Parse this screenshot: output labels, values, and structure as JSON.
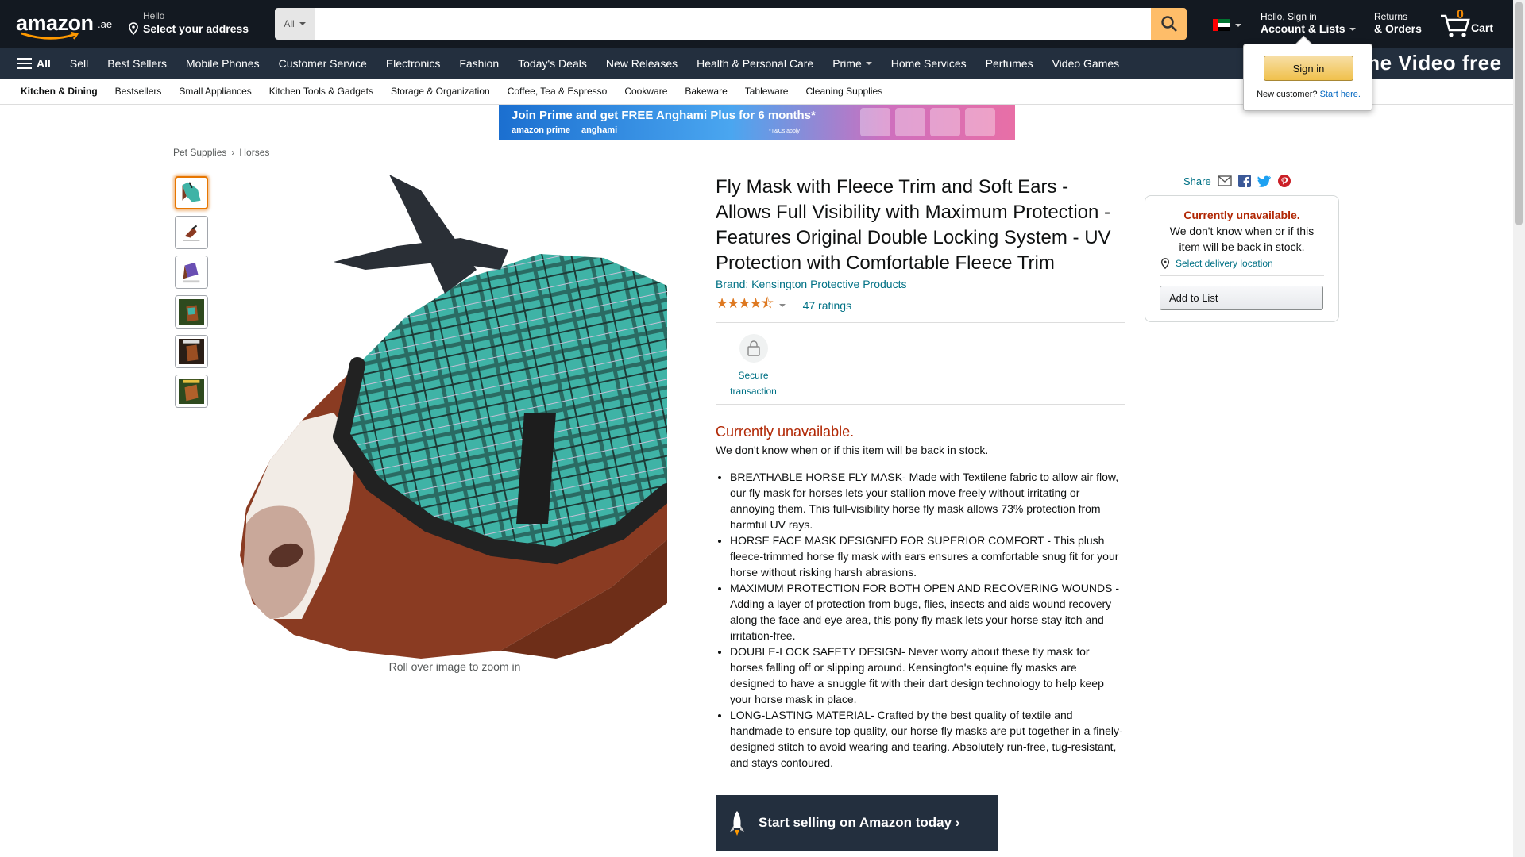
{
  "header": {
    "logo_text": "amazon",
    "logo_tld": ".ae",
    "address_hello": "Hello",
    "address_label": "Select your address",
    "search_category": "All",
    "search_placeholder": "",
    "account_hello": "Hello, Sign in",
    "account_label": "Account & Lists",
    "returns_l1": "Returns",
    "returns_l2": "& Orders",
    "cart_count": "0",
    "cart_label": "Cart"
  },
  "nav": {
    "all_label": "All",
    "items": [
      "Sell",
      "Best Sellers",
      "Mobile Phones",
      "Customer Service",
      "Electronics",
      "Fashion",
      "Today's Deals",
      "New Releases",
      "Health & Personal Care",
      "Prime",
      "Home Services",
      "Perfumes",
      "Video Games"
    ],
    "promo_text": "me Video free"
  },
  "subnav": {
    "items": [
      "Kitchen & Dining",
      "Bestsellers",
      "Small Appliances",
      "Kitchen Tools & Gadgets",
      "Storage & Organization",
      "Coffee, Tea & Espresso",
      "Cookware",
      "Bakeware",
      "Tableware",
      "Cleaning Supplies"
    ]
  },
  "banner": {
    "line1": "Join Prime and get FREE Anghami Plus for 6 months*",
    "brand_a": "amazon prime",
    "brand_b": "anghami",
    "tc": "*T&Cs apply"
  },
  "breadcrumb": [
    "Pet Supplies",
    "Horses"
  ],
  "gallery": {
    "zoom_hint": "Roll over image to zoom in"
  },
  "product": {
    "title": "Fly Mask with Fleece Trim and Soft Ears - Allows Full Visibility with Maximum Protection - Features Original Double Locking System - UV Protection with Comfortable Fleece Trim",
    "brand": "Brand: Kensington Protective Products",
    "stars_value": 4.5,
    "ratings": "47 ratings",
    "secure_label": "Secure transaction",
    "unavailable": "Currently unavailable.",
    "unavailable_sub": "We don't know when or if this item will be back in stock.",
    "bullets": [
      "BREATHABLE HORSE FLY MASK- Made with Textilene fabric to allow air flow, our fly mask for horses lets your stallion move freely without irritating or annoying them. This full-visibility horse fly mask allows 73% protection from harmful UV rays.",
      "HORSE FACE MASK DESIGNED FOR SUPERIOR COMFORT - This plush fleece-trimmed horse fly mask with ears ensures a comfortable snug fit for your horse without risking harsh abrasions.",
      "MAXIMUM PROTECTION FOR BOTH OPEN AND RECOVERING WOUNDS - Adding a layer of protection from bugs, flies, insects and aids wound recovery along the face and eye area, this pony fly mask lets your horse stay itch and irritation-free.",
      "DOUBLE-LOCK SAFETY DESIGN- Never worry about these fly mask for horses falling off or slipping around. Kensington's equine fly masks are designed to have a snuggle fit with their dart design technology to help keep your horse mask in place.",
      "LONG-LASTING MATERIAL- Crafted by the best quality of textile and handmade to ensure top quality, our horse fly masks are put together in a finely-designed stitch to avoid wearing and tearing. Absolutely run-free, tug-resistant, and stays contoured."
    ],
    "sell_banner": "Start selling on Amazon today ›"
  },
  "buybox": {
    "share_label": "Share",
    "unavailable": "Currently unavailable.",
    "sub": "We don't know when or if this item will be back in stock.",
    "location": "Select delivery location",
    "add_to_list": "Add to List"
  },
  "flyout": {
    "signin": "Sign in",
    "new_customer": "New customer?",
    "start_here": "Start here."
  },
  "colors": {
    "nav_dark": "#131921",
    "nav_secondary": "#232f3e",
    "search_button": "#febd69",
    "link": "#007185",
    "price_red": "#B12704",
    "star": "#de7921"
  }
}
